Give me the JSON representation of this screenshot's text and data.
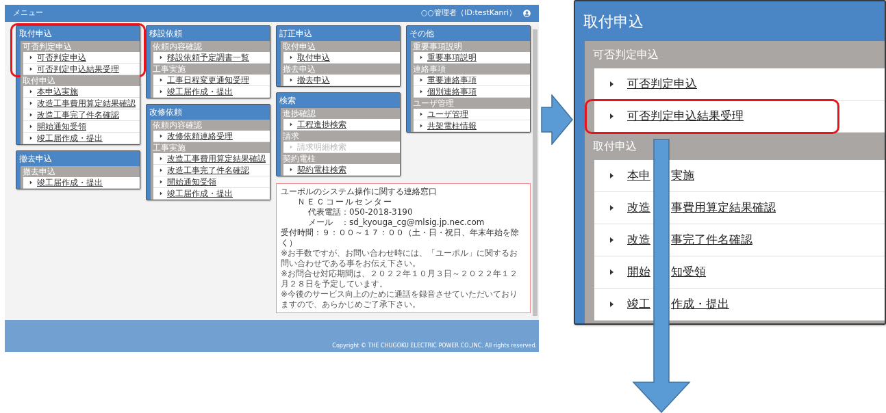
{
  "page": {
    "title": "メニュー",
    "user": "○○管理者（ID:testKanri）"
  },
  "columns": [
    {
      "panels": [
        {
          "title": "取付申込",
          "sections": [
            {
              "title": "可否判定申込",
              "highlighted": true,
              "items": [
                {
                  "label": "可否判定申込",
                  "disabled": false
                },
                {
                  "label": "可否判定申込結果受理",
                  "disabled": false
                }
              ]
            },
            {
              "title": "取付申込",
              "highlighted": false,
              "items": [
                {
                  "label": "本申込実施",
                  "disabled": false
                },
                {
                  "label": "改造工事費用算定結果確認",
                  "disabled": false
                },
                {
                  "label": "改造工事完了件名確認",
                  "disabled": false
                },
                {
                  "label": "開始通知受領",
                  "disabled": false
                },
                {
                  "label": "竣工届作成・提出",
                  "disabled": false
                }
              ]
            }
          ]
        },
        {
          "title": "撤去申込",
          "sections": [
            {
              "title": "撤去申込",
              "highlighted": false,
              "items": [
                {
                  "label": "竣工届作成・提出",
                  "disabled": false
                }
              ]
            }
          ]
        }
      ]
    },
    {
      "panels": [
        {
          "title": "移設依頼",
          "sections": [
            {
              "title": "依頼内容確認",
              "highlighted": false,
              "items": [
                {
                  "label": "移設依頼予定調書一覧",
                  "disabled": false
                }
              ]
            },
            {
              "title": "工事実施",
              "highlighted": false,
              "items": [
                {
                  "label": "工事日程変更通知受理",
                  "disabled": false
                },
                {
                  "label": "竣工届作成・提出",
                  "disabled": false
                }
              ]
            }
          ]
        },
        {
          "title": "改修依頼",
          "sections": [
            {
              "title": "依頼内容確認",
              "highlighted": false,
              "items": [
                {
                  "label": "改修依頼連絡受理",
                  "disabled": false
                }
              ]
            },
            {
              "title": "工事実施",
              "highlighted": false,
              "items": [
                {
                  "label": "改造工事費用算定結果確認",
                  "disabled": false
                },
                {
                  "label": "改造工事完了件名確認",
                  "disabled": false
                },
                {
                  "label": "開始通知受領",
                  "disabled": false
                },
                {
                  "label": "竣工届作成・提出",
                  "disabled": false
                }
              ]
            }
          ]
        }
      ]
    },
    {
      "panels": [
        {
          "title": "訂正申込",
          "sections": [
            {
              "title": "取付申込",
              "highlighted": false,
              "items": [
                {
                  "label": "取付申込",
                  "disabled": false
                }
              ]
            },
            {
              "title": "撤去申込",
              "highlighted": false,
              "items": [
                {
                  "label": "撤去申込",
                  "disabled": false
                }
              ]
            }
          ]
        },
        {
          "title": "検索",
          "sections": [
            {
              "title": "進捗確認",
              "highlighted": false,
              "items": [
                {
                  "label": "工程進捗検索",
                  "disabled": false
                }
              ]
            },
            {
              "title": "請求",
              "highlighted": false,
              "items": [
                {
                  "label": "請求明細検索",
                  "disabled": true
                }
              ]
            },
            {
              "title": "契約電柱",
              "highlighted": false,
              "items": [
                {
                  "label": "契約電柱検索",
                  "disabled": false
                }
              ]
            }
          ]
        }
      ]
    },
    {
      "panels": [
        {
          "title": "その他",
          "sections": [
            {
              "title": "重要事項説明",
              "highlighted": false,
              "items": [
                {
                  "label": "重要事項説明",
                  "disabled": false
                }
              ]
            },
            {
              "title": "連絡事項",
              "highlighted": false,
              "items": [
                {
                  "label": "重要連絡事項",
                  "disabled": false
                },
                {
                  "label": "個別連絡事項",
                  "disabled": false
                }
              ]
            },
            {
              "title": "ユーザ管理",
              "highlighted": false,
              "items": [
                {
                  "label": "ユーザ管理",
                  "disabled": false
                },
                {
                  "label": "共架電柱情報",
                  "disabled": false
                }
              ]
            }
          ]
        }
      ]
    }
  ],
  "notice": {
    "lines": [
      {
        "text": "ユーポルのシステム操作に関する連絡窓口",
        "kind": "plain"
      },
      {
        "text": "ＮＥＣコールセンター",
        "kind": "indented"
      },
      {
        "text": "代表電話：050-2018-3190",
        "kind": "subindented"
      },
      {
        "text": "メール　：sd_kyouga_cg@mlsig.jp.nec.com",
        "kind": "subindented"
      },
      {
        "text": "受付時間：９：００～１７：００（土・日・祝日、年末年始を除く）",
        "kind": "plain"
      },
      {
        "text": "※お手数ですが、お問い合わせ時には、「ユーポル」に関するお問い合わせである事をお伝え下さい。",
        "kind": "note"
      },
      {
        "text": "※お問合せ対応期間は、２０２２年１０月３日～２０２２年１２月２８日を予定しています。",
        "kind": "note"
      },
      {
        "text": "※今後のサービス向上のために通話を録音させていただいておりますので、あらかじめご了承下さい。",
        "kind": "note"
      }
    ]
  },
  "footer": {
    "copyright": "Copyright © THE CHUGOKU ELECTRIC POWER CO.,INC. All rights reserved."
  },
  "callout": {
    "title": "取付申込",
    "sections": [
      {
        "title": "可否判定申込",
        "items": [
          {
            "parts": [
              "可否判定申込"
            ],
            "highlighted": false
          },
          {
            "parts": [
              "可否判定申込結果受理"
            ],
            "highlighted": true
          }
        ]
      },
      {
        "title": "取付申込",
        "items": [
          {
            "parts": [
              "本申",
              "実施"
            ],
            "highlighted": false
          },
          {
            "parts": [
              "改造",
              "事費用算定結果確認"
            ],
            "highlighted": false
          },
          {
            "parts": [
              "改造",
              "事完了件名確認"
            ],
            "highlighted": false
          },
          {
            "parts": [
              "開始",
              "知受領"
            ],
            "highlighted": false
          },
          {
            "parts": [
              "竣工",
              "作成・提出"
            ],
            "highlighted": false
          }
        ]
      }
    ]
  }
}
